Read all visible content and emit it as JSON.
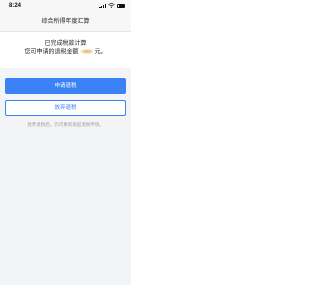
{
  "status_bar": {
    "time": "8:24"
  },
  "nav": {
    "title": "综合所得年度汇算"
  },
  "result": {
    "title": "已完成税款计算",
    "line_prefix": "您可申请的退税金额",
    "line_suffix": "元。"
  },
  "actions": {
    "apply_label": "申请退税",
    "abandon_label": "放弃退税",
    "hint": "放弃退税后，仍可重新发起退税申请。"
  },
  "colors": {
    "accent": "#3b82f6",
    "background": "#f3f4f6"
  },
  "icons": [
    "signal-icon",
    "wifi-icon",
    "battery-icon"
  ]
}
